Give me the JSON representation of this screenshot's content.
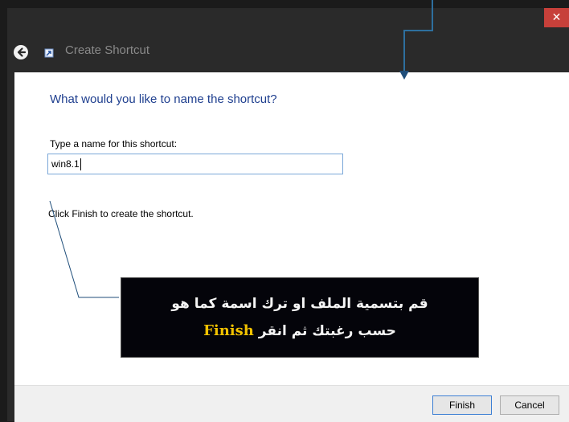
{
  "window": {
    "title": "Create Shortcut",
    "close_glyph": "✕"
  },
  "page": {
    "heading": "What would you like to name the shortcut?",
    "name_label": "Type a name for this shortcut:",
    "name_value": "win8.1",
    "finish_hint": "Click Finish to create the shortcut."
  },
  "callout": {
    "line1": "قم بتسمية الملف او ترك اسمة كما هو",
    "line2_prefix": "حسب رغبتك ثم انقر ",
    "line2_accent": "Finish",
    "accent_color": "#f2c200"
  },
  "footer": {
    "finish_label": "Finish",
    "cancel_label": "Cancel"
  },
  "icons": {
    "back": "back-arrow-icon",
    "app": "shortcut-app-icon",
    "close": "close-icon"
  }
}
